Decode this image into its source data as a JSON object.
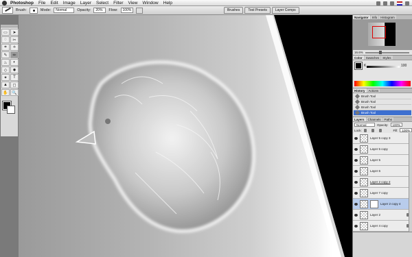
{
  "menubar": {
    "app": "Photoshop",
    "items": [
      "File",
      "Edit",
      "Image",
      "Layer",
      "Select",
      "Filter",
      "View",
      "Window",
      "Help"
    ]
  },
  "options": {
    "brush_label": "Brush:",
    "mode_label": "Mode:",
    "mode_value": "Normal",
    "opacity_label": "Opacity:",
    "opacity_value": "20%",
    "flow_label": "Flow:",
    "flow_value": "100%"
  },
  "palette_well": {
    "tabs": [
      "Brushes",
      "Tool Presets",
      "Layer Comps"
    ]
  },
  "tools": [
    "▭",
    "➤",
    "◌",
    "✂",
    "⌗",
    "⟡",
    "✎",
    "✏",
    "♨",
    "◐",
    "◇",
    "✹",
    "✦",
    "T",
    "▲",
    "◻",
    "✋",
    "🔍"
  ],
  "navigator": {
    "tabs": [
      "Navigator",
      "Info",
      "Histogram"
    ],
    "zoom": "16.6%"
  },
  "color": {
    "tabs": [
      "Color",
      "Swatches",
      "Styles"
    ],
    "channel_label": "K",
    "channel_value": "100"
  },
  "history": {
    "tabs": [
      "History",
      "Actions"
    ],
    "rows": [
      "Brush Tool",
      "Brush Tool",
      "Brush Tool",
      "Brush Tool"
    ]
  },
  "layers": {
    "tabs": [
      "Layers",
      "Channels",
      "Paths"
    ],
    "blend": "Normal",
    "opacity_label": "Opacity:",
    "opacity": "100%",
    "lock_label": "Lock:",
    "fill_label": "Fill:",
    "fill": "100%",
    "rows": [
      {
        "name": "Layer 5 copy 3",
        "link": false
      },
      {
        "name": "Layer 5 copy",
        "link": false
      },
      {
        "name": "Layer 5",
        "link": false
      },
      {
        "name": "Layer 6",
        "link": false
      },
      {
        "name": "Layer 2 copy 2",
        "link": true
      },
      {
        "name": "Layer 7 copy",
        "link": false
      },
      {
        "name": "Layer 2 copy 4",
        "link": false
      },
      {
        "name": "Layer 2",
        "link": false
      },
      {
        "name": "Layer 4 copy",
        "link": false
      }
    ]
  }
}
